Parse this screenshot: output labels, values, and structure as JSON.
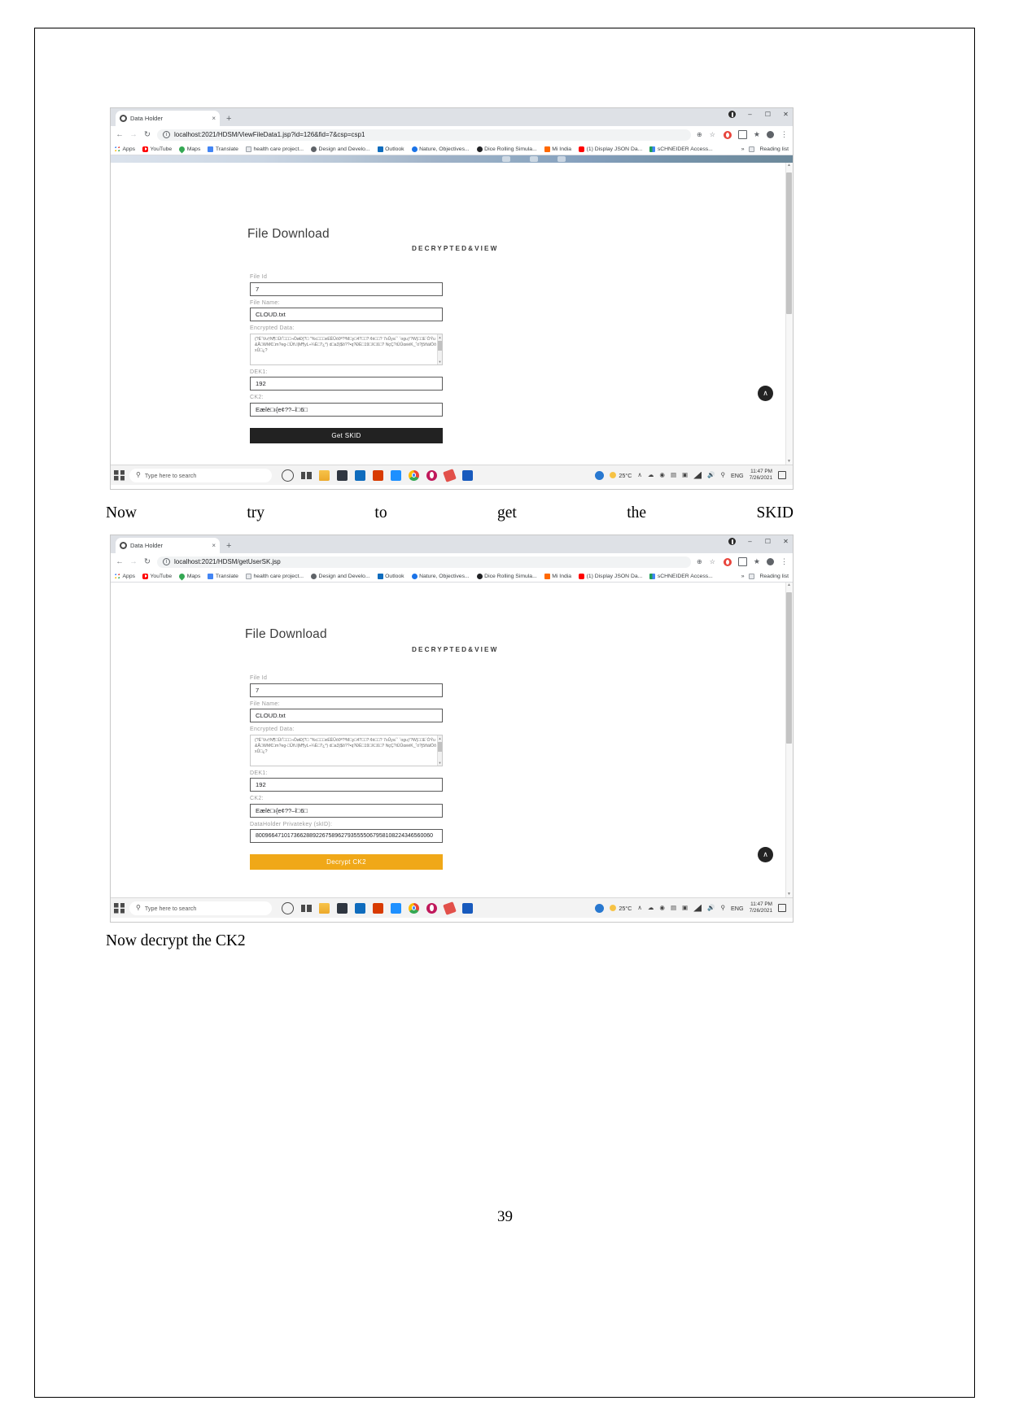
{
  "document": {
    "page_number": "39",
    "captions": {
      "caption1_words": [
        "Now",
        "try",
        "to",
        "get",
        "the",
        "SKID"
      ],
      "caption2": "Now decrypt the CK2"
    }
  },
  "browser": {
    "tab": {
      "title": "Data Holder",
      "close_label": "×",
      "favicon": "shield-icon"
    },
    "newtab_label": "+",
    "window_controls": {
      "minimize": "–",
      "maximize": "☐",
      "close": "✕"
    },
    "nav": {
      "back": "←",
      "forward": "→",
      "reload": "↻"
    },
    "omnibox": {
      "info_icon": "ⓘ",
      "zoom_icon": "⊕",
      "star_icon": "☆"
    },
    "extensions": {
      "more_icon": "⋮"
    },
    "bookmarks": [
      {
        "label": "Apps",
        "icon": "apps-grid-icon"
      },
      {
        "label": "YouTube",
        "icon": "youtube-icon"
      },
      {
        "label": "Maps",
        "icon": "maps-pin-icon"
      },
      {
        "label": "Translate",
        "icon": "translate-icon"
      },
      {
        "label": "health care project...",
        "icon": "document-icon"
      },
      {
        "label": "Design and Develo...",
        "icon": "w-circle-icon"
      },
      {
        "label": "Outlook",
        "icon": "outlook-icon"
      },
      {
        "label": "Nature, Objectives...",
        "icon": "globe-icon"
      },
      {
        "label": "Dice Rolling Simula...",
        "icon": "dice-icon"
      },
      {
        "label": "Mi India",
        "icon": "mi-icon"
      },
      {
        "label": "(1) Display JSON Da...",
        "icon": "youtube-icon"
      },
      {
        "label": "sCHNEIDER Access...",
        "icon": "schneider-icon"
      }
    ],
    "bookmarks_overflow": "»",
    "reading_list": {
      "label": "Reading list",
      "icon": "reading-list-icon"
    }
  },
  "window1": {
    "url": "localhost:2021/HDSM/ViewFileData1.jsp?id=126&fid=7&csp=csp1",
    "page": {
      "heading": "File Download",
      "subheading": "DECRYPTED&VIEW",
      "fields": [
        {
          "label": "File Id",
          "value": "7",
          "name": "file-id-input"
        },
        {
          "label": "File Name:",
          "value": "CLOUD.txt",
          "name": "file-name-input"
        },
        {
          "label": "Encrypted Data:",
          "value": "(?ÉˇVu†N¶□Üí˚□□□¬ÒøÐ{?□ ˜%c□□□eÉËÛó0ª?³M□y□4?□□?:¢è□□?\n7sÛyaˇˇ ˇoguƒ?W|□□E´ÒÝu&Å□WM€□m?eg-□Ûñ.I|M¶yL÷¼È□?¿*) d□a3)$ô??•q?ÐÈ□19□X□ß□? NçÇ?iÚÛœiéK_˚ó?j5ñàlÓôxÛ□¿?",
          "name": "encrypted-data-textarea"
        },
        {
          "label": "DEK1:",
          "value": "192",
          "name": "dek1-input"
        },
        {
          "label": "CK2:",
          "value": "Eæîë□ı{e¢??–î□6□",
          "name": "ck2-input"
        }
      ],
      "button": {
        "label": "Get SKID",
        "name": "get-skid-button",
        "color": "#222222"
      },
      "back_to_top": "∧"
    }
  },
  "window2": {
    "url": "localhost:2021/HDSM/getUserSK.jsp",
    "page": {
      "heading": "File Download",
      "subheading": "DECRYPTED&VIEW",
      "fields": [
        {
          "label": "File Id",
          "value": "7",
          "name": "file-id-input"
        },
        {
          "label": "File Name:",
          "value": "CLOUD.txt",
          "name": "file-name-input"
        },
        {
          "label": "Encrypted Data:",
          "value": "(?ÉˇVu†N¶□Üí˚□□□¬ÒøÐ{?□ ˜%c□□□eÉËÛó0ª?³M□y□4?□□?:¢è□□?\n7sÛyaˇˇ ˇoguƒ?W|□□E´ÒÝu&Å□WM€□m?eg-□Ûñ.I|M¶yL÷¼È□?¿*) d□a3)$ô??•q?ÐÈ□19□X□ß□? NçÇ?iÚÛœiéK_˚ó?j5ñàlÓôxÛ□¿?",
          "name": "encrypted-data-textarea"
        },
        {
          "label": "DEK1:",
          "value": "192",
          "name": "dek1-input"
        },
        {
          "label": "CK2:",
          "value": "Eæîë□ı{e¢??–î□6□",
          "name": "ck2-input"
        },
        {
          "label": "DataHolder Privatekey (skID):",
          "value": "80096647101736628892267589627935555067958108224346560060",
          "name": "dataholder-privatekey-input"
        }
      ],
      "button": {
        "label": "Decrypt CK2",
        "name": "decrypt-ck2-button",
        "color": "#f0a818"
      },
      "back_to_top": "∧"
    }
  },
  "taskbar": {
    "search_placeholder": "Type here to search",
    "search_icon": "search-icon",
    "start_icon": "windows-start-icon",
    "icons": [
      "cortana-circle-icon",
      "task-view-icon",
      "file-explorer-icon",
      "store-icon",
      "outlook-icon",
      "office-icon",
      "mail-icon",
      "chrome-icon",
      "opera-icon",
      "pen-icon",
      "word-icon"
    ],
    "tray": {
      "weather_temp": "25°C",
      "show_hidden": "∧",
      "onedrive": "☁",
      "network_icon": "network-icon",
      "volume_icon": "ᴘ",
      "language": "ENG",
      "time": "11:47 PM",
      "date": "7/26/2021",
      "notification_icon": "notification-icon"
    }
  }
}
